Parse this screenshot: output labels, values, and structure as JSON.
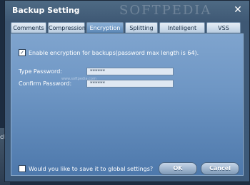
{
  "background": {
    "left_text": "cku"
  },
  "dialog": {
    "title": "Backup Setting",
    "watermark": "SOFTPEDIA",
    "close_glyph": "✕"
  },
  "tabs": [
    {
      "label": "Comments",
      "active": false
    },
    {
      "label": "Compression",
      "active": false
    },
    {
      "label": "Encryption",
      "active": true
    },
    {
      "label": "Splitting",
      "active": false
    },
    {
      "label": "Intelligent Sector",
      "active": false
    },
    {
      "label": "VSS",
      "active": false
    }
  ],
  "encryption": {
    "enable_label": "Enable encryption for backups(password max length is 64).",
    "enable_checked": true,
    "check_glyph": "✓",
    "url_text": "www.softpedia.com",
    "password_label": "Type Password:",
    "password_value": "******",
    "confirm_label": "Confirm Password:",
    "confirm_value": "******"
  },
  "footer": {
    "global_label": "Would you like to save it to global settings?",
    "global_checked": false,
    "ok_label": "OK",
    "cancel_label": "Cancel"
  },
  "colors": {
    "dialog_bg": "#3d5a7a",
    "panel_bg": "#6e96c4",
    "active_tab": "#5a86b6"
  }
}
